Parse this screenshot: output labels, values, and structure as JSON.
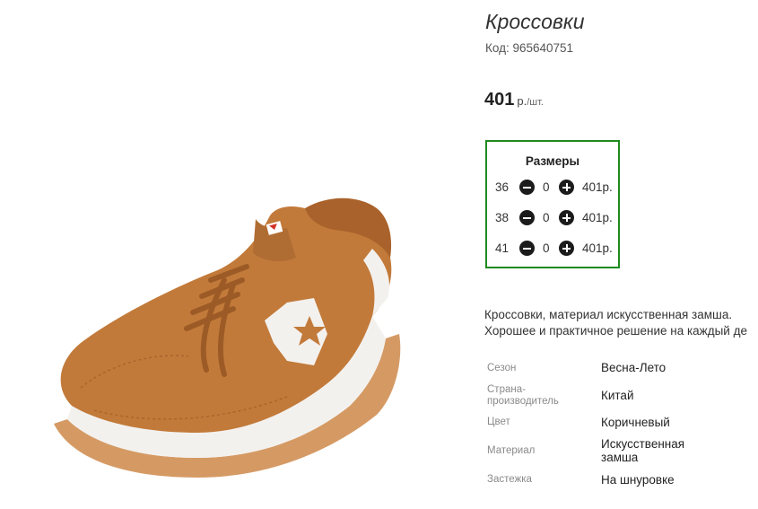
{
  "product": {
    "title": "Кроссовки",
    "sku_label": "Код:",
    "sku_value": "965640751",
    "price_value": "401",
    "price_currency": "р.",
    "price_per": "/шт.",
    "image": "brown-sneaker-photo"
  },
  "sizes": {
    "title": "Размеры",
    "rows": [
      {
        "size": "36",
        "qty": "0",
        "price": "401р."
      },
      {
        "size": "38",
        "qty": "0",
        "price": "401р."
      },
      {
        "size": "41",
        "qty": "0",
        "price": "401р."
      }
    ],
    "minus_icon": "minus-circle-icon",
    "plus_icon": "plus-circle-icon",
    "accent_color": "#1e8a1e"
  },
  "description": {
    "line1": "Кроссовки, материал искусственная замша.",
    "line2": "Хорошее и практичное решение на каждый де"
  },
  "specs": [
    {
      "name": "Сезон",
      "value": "Весна-Лето"
    },
    {
      "name": "Страна-производитель",
      "value": "Китай"
    },
    {
      "name": "Цвет",
      "value": "Коричневый"
    },
    {
      "name": "Материал",
      "value": "Искусственная замша"
    },
    {
      "name": "Застежка",
      "value": "На шнуровке"
    }
  ]
}
